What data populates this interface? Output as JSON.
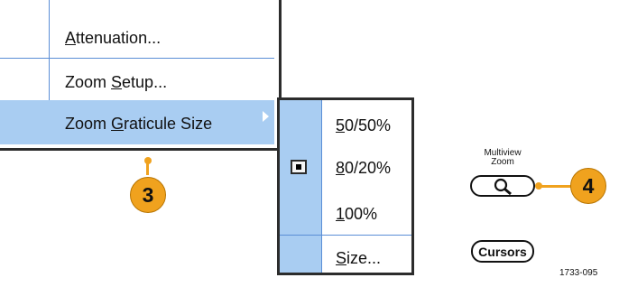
{
  "main_menu": {
    "items": [
      {
        "label_pre": "",
        "label_u": "A",
        "label_post": "ttenuation..."
      },
      {
        "label_pre": "Zoom ",
        "label_u": "S",
        "label_post": "etup..."
      },
      {
        "label_pre": "Zoom ",
        "label_u": "G",
        "label_post": "raticule Size"
      }
    ],
    "highlight_color": "#a9cdf2"
  },
  "submenu": {
    "items": [
      {
        "label_pre": "",
        "label_u": "5",
        "label_post": "0/50%",
        "selected": false
      },
      {
        "label_pre": "",
        "label_u": "8",
        "label_post": "0/20%",
        "selected": true
      },
      {
        "label_pre": "",
        "label_u": "1",
        "label_post": "00%",
        "selected": false
      },
      {
        "label_pre": "",
        "label_u": "S",
        "label_post": "ize...",
        "selected": false
      }
    ]
  },
  "callouts": {
    "step_a": "3",
    "step_b": "4",
    "color": "#f0a21e"
  },
  "buttons": {
    "multiview_zoom_caption_1": "Multiview",
    "multiview_zoom_caption_2": "Zoom",
    "multiview_zoom_icon": "magnifier-icon",
    "cursors_label": "Cursors"
  },
  "figure_id": "1733-095"
}
